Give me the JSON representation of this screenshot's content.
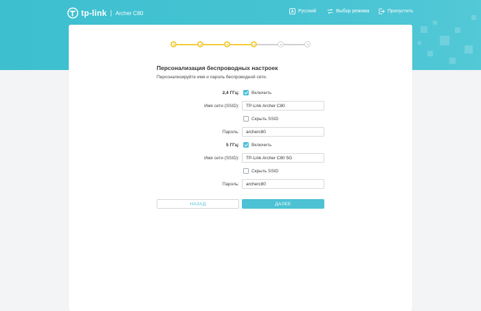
{
  "header": {
    "brand": "tp-link",
    "separator": "|",
    "model": "Archer C80",
    "nav": [
      {
        "label": "Русский",
        "icon": "language-icon"
      },
      {
        "label": "Выбор режима",
        "icon": "mode-switch-icon"
      },
      {
        "label": "Пропустить",
        "icon": "skip-icon"
      }
    ]
  },
  "stepper": {
    "total_steps": 6,
    "completed_steps": 4,
    "active_color": "#f2cc3b",
    "inactive_color": "#d0d0d0"
  },
  "form": {
    "title": "Персонализация беспроводных настроек",
    "subtitle": "Персонализируйте имя и пароль беспроводной сети.",
    "band_24": {
      "label": "2,4 ГГц:",
      "enable_label": "Включить",
      "enabled": true,
      "ssid_label": "Имя сети (SSID):",
      "ssid_value": "TP-Link Archer C80",
      "hide_ssid_label": "Скрыть SSID",
      "hide_ssid": false,
      "password_label": "Пароль:",
      "password_value": "archerc80"
    },
    "band_5": {
      "label": "5 ГГц:",
      "enable_label": "Включить",
      "enabled": true,
      "ssid_label": "Имя сети (SSID):",
      "ssid_value": "TP-Link Archer C80 5G",
      "hide_ssid_label": "Скрыть SSID",
      "hide_ssid": false,
      "password_label": "Пароль:",
      "password_value": "archerc80"
    },
    "back_label": "НАЗАД",
    "next_label": "ДАЛЕЕ"
  },
  "colors": {
    "accent": "#4dc2d4",
    "header_band": "#46c3d3",
    "page_background": "#f2f4f5"
  }
}
